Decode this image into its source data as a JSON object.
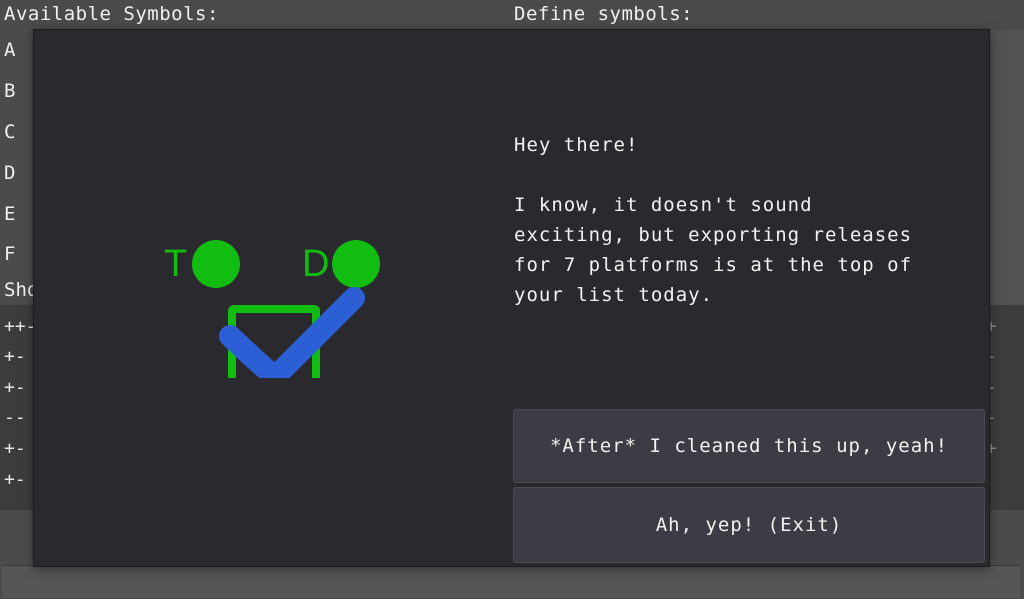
{
  "background": {
    "left_title": "Available Symbols:",
    "right_title": "Define symbols:",
    "symbols": [
      "A",
      "B",
      "C",
      "D",
      "E",
      "F",
      "Sho"
    ],
    "grid_rows": [
      "++-",
      "+-",
      "+-",
      "--",
      "+-",
      "+-"
    ],
    "grid_right": [
      "+",
      "-",
      "-",
      "-",
      "+"
    ]
  },
  "dialog": {
    "logo": {
      "letters": [
        "T",
        "D"
      ],
      "colors": {
        "green": "#12bd12",
        "blue": "#2c5ed6"
      }
    },
    "message": "Hey there!\n\nI know, it doesn't sound\nexciting, but exporting releases\nfor 7 platforms is at the top of\nyour list today.",
    "choices": [
      "*After* I cleaned this up, yeah!",
      "Ah, yep! (Exit)"
    ]
  }
}
